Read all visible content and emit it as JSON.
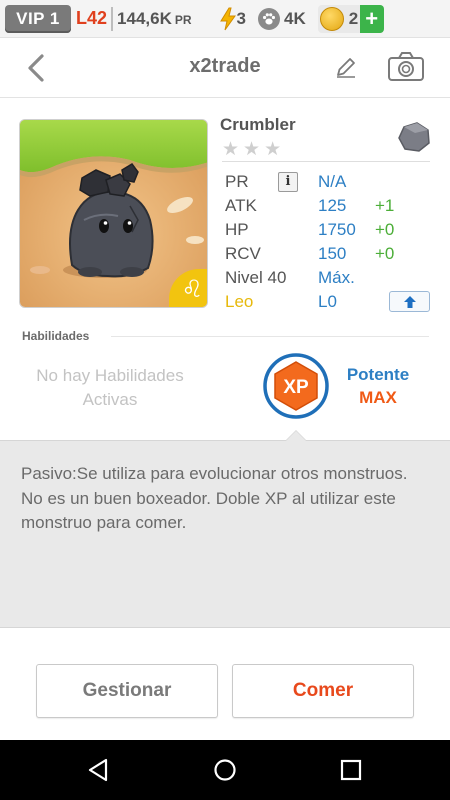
{
  "status_bar": {
    "vip": "VIP 1",
    "level": "L42",
    "power_value": "144,6K",
    "power_unit": "PR",
    "energy": "3",
    "paw_count": "4K",
    "coins": "2",
    "add_label": "+"
  },
  "header": {
    "title": "x2trade"
  },
  "monster": {
    "name": "Crumbler",
    "stars_total": 3,
    "zodiac_symbol": "♌",
    "stats": [
      {
        "key": "PR",
        "value": "N/A",
        "bonus": ""
      },
      {
        "key": "ATK",
        "value": "125",
        "bonus": "+1"
      },
      {
        "key": "HP",
        "value": "1750",
        "bonus": "+0"
      },
      {
        "key": "RCV",
        "value": "150",
        "bonus": "+0"
      },
      {
        "key": "Nivel 40",
        "value": "Máx.",
        "bonus": ""
      },
      {
        "key": "Leo",
        "value": "L0",
        "bonus": ""
      }
    ]
  },
  "abilities": {
    "section_label": "Habilidades",
    "none_text": "No hay Habilidades Activas",
    "badge_text": "XP",
    "passive_name": "Potente",
    "passive_level": "MAX"
  },
  "description": "Pasivo:Se utiliza para evolucionar otros monstruos. No es un buen boxeador. Doble XP al utilizar este monstruo para comer.",
  "actions": {
    "manage_label": "Gestionar",
    "eat_label": "Comer"
  },
  "colors": {
    "accent_blue": "#2d7fc4",
    "accent_orange": "#f05a16",
    "bonus_green": "#4cae38",
    "leo_yellow": "#e7b90c"
  }
}
